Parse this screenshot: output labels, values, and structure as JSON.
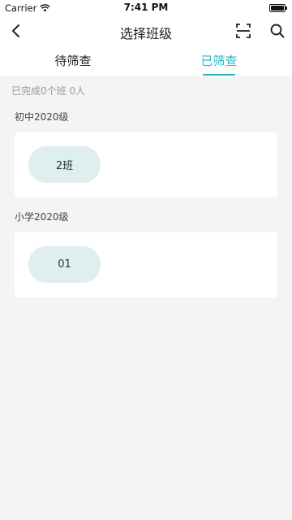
{
  "status_bar": {
    "carrier": "Carrier",
    "time": "7:41 PM"
  },
  "nav": {
    "title": "选择班级",
    "icons": [
      "back-arrow-icon",
      "scan-icon",
      "search-icon"
    ]
  },
  "tabs": [
    {
      "label": "待筛查",
      "active": false
    },
    {
      "label": "已筛查",
      "active": true
    }
  ],
  "accent_color": "#2fb5bd",
  "summary": "已完成0个班 0人",
  "groups": [
    {
      "label": "初中2020级",
      "classes": [
        "2班"
      ]
    },
    {
      "label": "小学2020级",
      "classes": [
        "01"
      ]
    }
  ]
}
